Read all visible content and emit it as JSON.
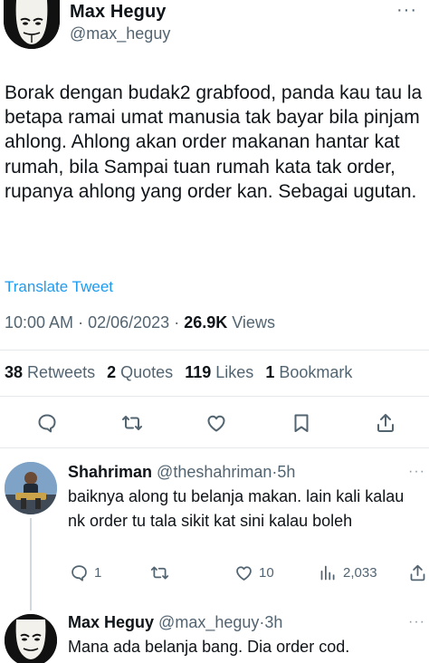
{
  "tweet": {
    "author_name": "Max Heguy",
    "author_handle": "@max_heguy",
    "text": "Borak dengan budak2 grabfood, panda kau tau la betapa ramai umat manusia tak bayar bila pinjam ahlong. Ahlong akan order makanan hantar kat rumah, bila Sampai tuan rumah kata tak order, rupanya ahlong yang order kan. Sebagai ugutan.",
    "translate_label": "Translate Tweet",
    "time": "10:00 AM",
    "date": "02/06/2023",
    "views_count": "26.9K",
    "views_label": "Views",
    "retweets_count": "38",
    "retweets_label": "Retweets",
    "quotes_count": "2",
    "quotes_label": "Quotes",
    "likes_count": "119",
    "likes_label": "Likes",
    "bookmarks_count": "1",
    "bookmarks_label": "Bookmark",
    "more_label": "···"
  },
  "replies": [
    {
      "name": "Shahriman",
      "handle": "@theshahriman",
      "time": "5h",
      "text": "baiknya along tu belanja makan. lain kali kalau nk order tu tala sikit kat sini kalau boleh",
      "reply_count": "1",
      "like_count": "10",
      "views_count": "2,033",
      "more_label": "···"
    },
    {
      "name": "Max Heguy",
      "handle": "@max_heguy",
      "time": "3h",
      "text": "Mana ada belanja bang. Dia order cod.",
      "more_label": "···"
    }
  ],
  "icons": {
    "reply": "reply-icon",
    "retweet": "retweet-icon",
    "like": "heart-icon",
    "bookmark": "bookmark-icon",
    "share": "share-icon",
    "views": "views-icon"
  },
  "colors": {
    "text": "#0f1419",
    "secondary": "#536471",
    "link": "#1d9bf0",
    "divider": "#e6e9ec"
  }
}
